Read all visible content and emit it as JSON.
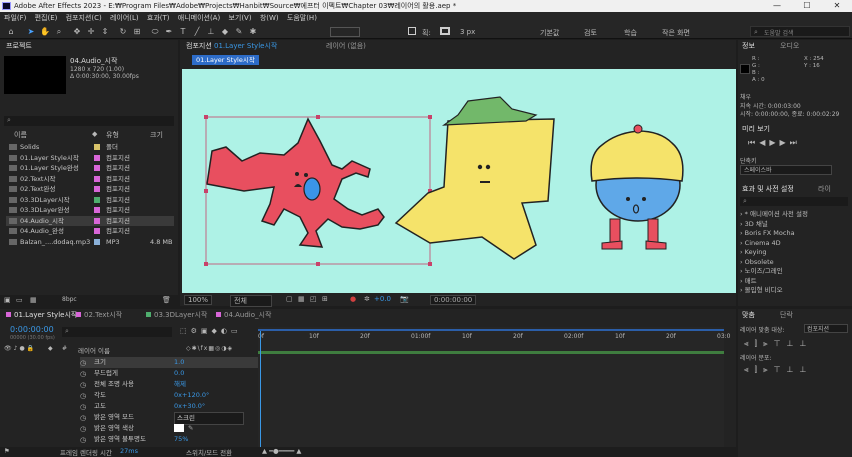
{
  "window": {
    "title": "Adobe After Effects 2023 - E:₩Program Files₩Adobe₩Projects₩Hanbit₩Source₩에프터 이펙트₩Chapter 03₩레이어의 활용.aep *",
    "minimize": "—",
    "maximize": "☐",
    "close": "✕"
  },
  "menu": [
    "파일(F)",
    "편집(E)",
    "컴포지션(C)",
    "레이어(L)",
    "효과(T)",
    "애니메이션(A)",
    "보기(V)",
    "창(W)",
    "도움말(H)"
  ],
  "toolbar": {
    "px_label": "3 px",
    "fill_label": "획:",
    "workspaces": [
      "기본값",
      "검토",
      "학습",
      "작은 화면"
    ],
    "search_placeholder": "도움말 검색"
  },
  "project": {
    "tab": "프로젝트",
    "preview_name": "04.Audio_시작",
    "preview_info1": "1280 x 720 (1.00)",
    "preview_info2": "Δ 0:00:30:00, 30.00fps",
    "col_name": "이름",
    "col_type": "유형",
    "col_size": "크기",
    "items": [
      {
        "name": "Solids",
        "type": "폴더",
        "size": "",
        "color": "#d8c36a",
        "icon": "folder-icon"
      },
      {
        "name": "01.Layer Style시작",
        "type": "컴포지션",
        "size": "",
        "color": "#d866d8",
        "icon": "composition-icon"
      },
      {
        "name": "01.Layer Style완성",
        "type": "컴포지션",
        "size": "",
        "color": "#d866d8",
        "icon": "composition-icon"
      },
      {
        "name": "02.Text시작",
        "type": "컴포지션",
        "size": "",
        "color": "#d866d8",
        "icon": "composition-icon"
      },
      {
        "name": "02.Text완성",
        "type": "컴포지션",
        "size": "",
        "color": "#d866d8",
        "icon": "composition-icon"
      },
      {
        "name": "03.3DLayer시작",
        "type": "컴포지션",
        "size": "",
        "color": "#4fae6e",
        "icon": "composition-icon"
      },
      {
        "name": "03.3DLayer완성",
        "type": "컴포지션",
        "size": "",
        "color": "#d866d8",
        "icon": "composition-icon"
      },
      {
        "name": "04.Audio_시작",
        "type": "컴포지션",
        "size": "",
        "color": "#d866d8",
        "icon": "composition-icon",
        "selected": true
      },
      {
        "name": "04.Audio_완성",
        "type": "컴포지션",
        "size": "",
        "color": "#d866d8",
        "icon": "composition-icon"
      },
      {
        "name": "Balzan_....dodaq.mp3",
        "type": "MP3",
        "size": "4.8 MB",
        "color": "#8ab0d8",
        "icon": "audio-file-icon"
      }
    ],
    "bpc": "8bpc"
  },
  "comp": {
    "tab": "컴포지션",
    "tab_name": "01.Layer Style시작",
    "layer_tab": "레이어 (없음)",
    "breadcrumb": "01.Layer Style시작",
    "zoom": "100%",
    "resolution": "전체",
    "exposure": "+0.0",
    "timecode": "0:00:00:00",
    "bg_color": "#aef2e6"
  },
  "timeline": {
    "tabs": [
      "01.Layer Style시작",
      "02.Text시작",
      "03.3DLayer시작",
      "04.Audio_시작"
    ],
    "timecode": "0:00:00:00",
    "fps_line": "00000 (30.00 fps)",
    "layer_name_header": "레이어 이름",
    "ruler": [
      "0f",
      "10f",
      "20f",
      "01:00f",
      "10f",
      "20f",
      "02:00f",
      "10f",
      "20f",
      "03:0"
    ],
    "properties": [
      {
        "name": "크기",
        "value": "1.0"
      },
      {
        "name": "부드럽게",
        "value": "0.0"
      },
      {
        "name": "전체 조명 사용",
        "value": "해제"
      },
      {
        "name": "각도",
        "value": "0x+120.0°"
      },
      {
        "name": "고도",
        "value": "0x+30.0°"
      },
      {
        "name": "밝은 영역 모드",
        "value": "스크린"
      },
      {
        "name": "밝은 영역 색상",
        "value": ""
      },
      {
        "name": "밝은 영역 불투명도",
        "value": "75%"
      }
    ],
    "footer_left": "프레임 렌더링 시간",
    "footer_ms": "27ms",
    "footer_mid": "스위치/모드 전환"
  },
  "info": {
    "tab": "정보",
    "audio_tab": "오디오",
    "r": "R :",
    "g": "G :",
    "b": "B :",
    "a": "A : 0",
    "x": "X : 254",
    "y": "Y : 16",
    "fill_label": "채우",
    "start": "지속 시간: 0:00:03:00",
    "duration": "시작: 0:00:00:00, 종료: 0:00:02:29"
  },
  "preview": {
    "tab": "미리 보기",
    "shortcut_label": "단축키",
    "shortcut_value": "스페이스바"
  },
  "effects": {
    "tab": "효과 및 사전 설정",
    "lib_tab": "라이",
    "items": [
      "* 애니메이션 사전 설정",
      "3D 채널",
      "Boris FX Mocha",
      "Cinema 4D",
      "Keying",
      "Obsolete",
      "노이즈/그레인",
      "매트",
      "몰입형 비디오"
    ]
  },
  "align": {
    "tab": "맞춤",
    "para_tab": "단락",
    "align_label": "레이어 맞춤 대상:",
    "align_target": "컴포지션",
    "distribute_label": "레이어 분포:"
  }
}
